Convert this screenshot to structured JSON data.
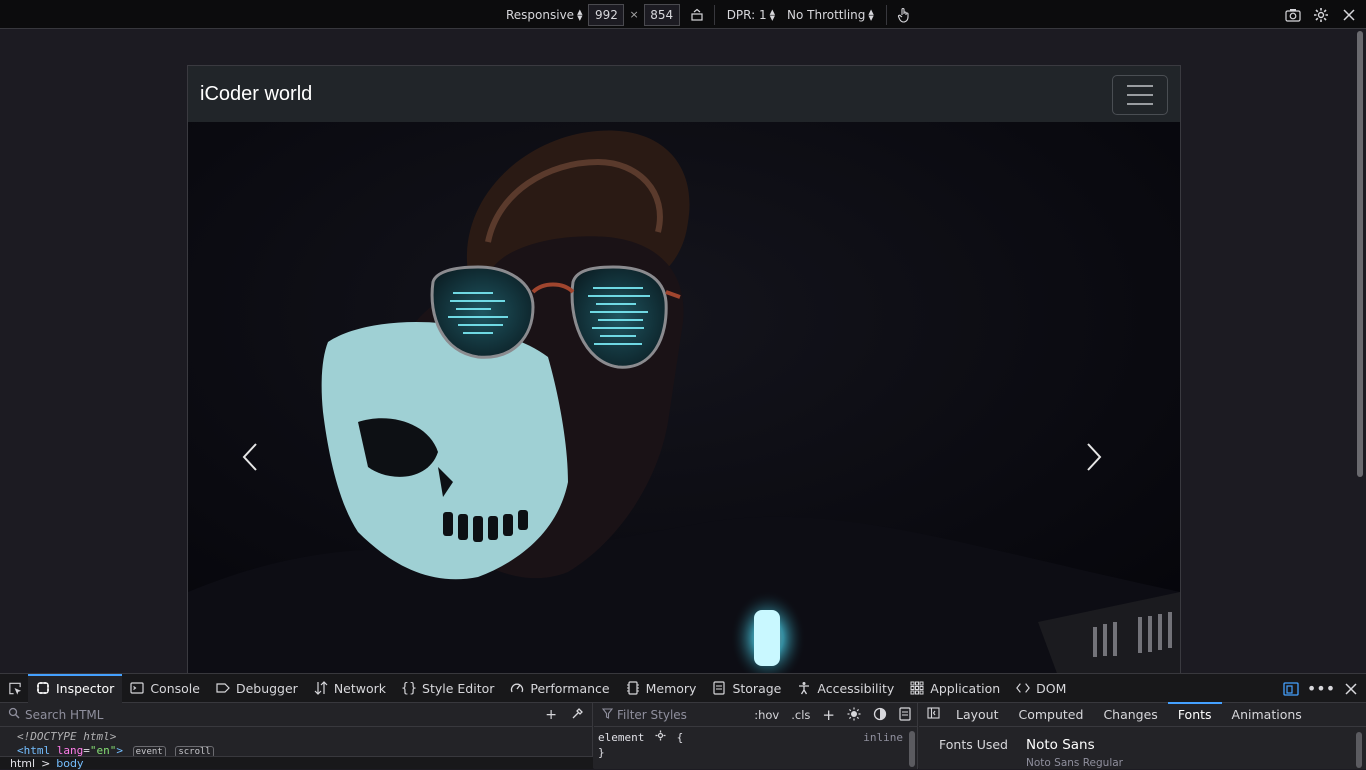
{
  "rdm_toolbar": {
    "device_label": "Responsive",
    "width": "992",
    "height": "854",
    "times": "×",
    "dpr_label": "DPR: 1",
    "throttling_label": "No Throttling"
  },
  "site": {
    "brand": "iCoder world"
  },
  "devtools": {
    "tabs": [
      {
        "label": "Inspector",
        "icon": "inspector-icon"
      },
      {
        "label": "Console",
        "icon": "console-icon"
      },
      {
        "label": "Debugger",
        "icon": "debugger-icon"
      },
      {
        "label": "Network",
        "icon": "network-icon"
      },
      {
        "label": "Style Editor",
        "icon": "style-editor-icon"
      },
      {
        "label": "Performance",
        "icon": "performance-icon"
      },
      {
        "label": "Memory",
        "icon": "memory-icon"
      },
      {
        "label": "Storage",
        "icon": "storage-icon"
      },
      {
        "label": "Accessibility",
        "icon": "accessibility-icon"
      },
      {
        "label": "Application",
        "icon": "application-icon"
      },
      {
        "label": "DOM",
        "icon": "dom-icon"
      }
    ],
    "html_pane": {
      "search_placeholder": "Search HTML",
      "doctype": "<!DOCTYPE html>",
      "html_tag_open": "<html",
      "html_attr_name": "lang",
      "html_attr_val": "\"en\"",
      "html_tag_close": ">",
      "badge_event": "event",
      "badge_scroll": "scroll",
      "crumb_html": "html",
      "crumb_sep": ">",
      "crumb_body": "body"
    },
    "rules_pane": {
      "filter_placeholder": "Filter Styles",
      "hov": ":hov",
      "cls": ".cls",
      "element_selector": "element",
      "brace_open": "{",
      "brace_close": "}",
      "inline_label": "inline"
    },
    "side_pane": {
      "tabs": [
        "Layout",
        "Computed",
        "Changes",
        "Fonts",
        "Animations"
      ],
      "active_tab": "Fonts",
      "fonts_used_label": "Fonts Used",
      "font_name": "Noto Sans",
      "font_variant": "Noto Sans Regular"
    }
  }
}
